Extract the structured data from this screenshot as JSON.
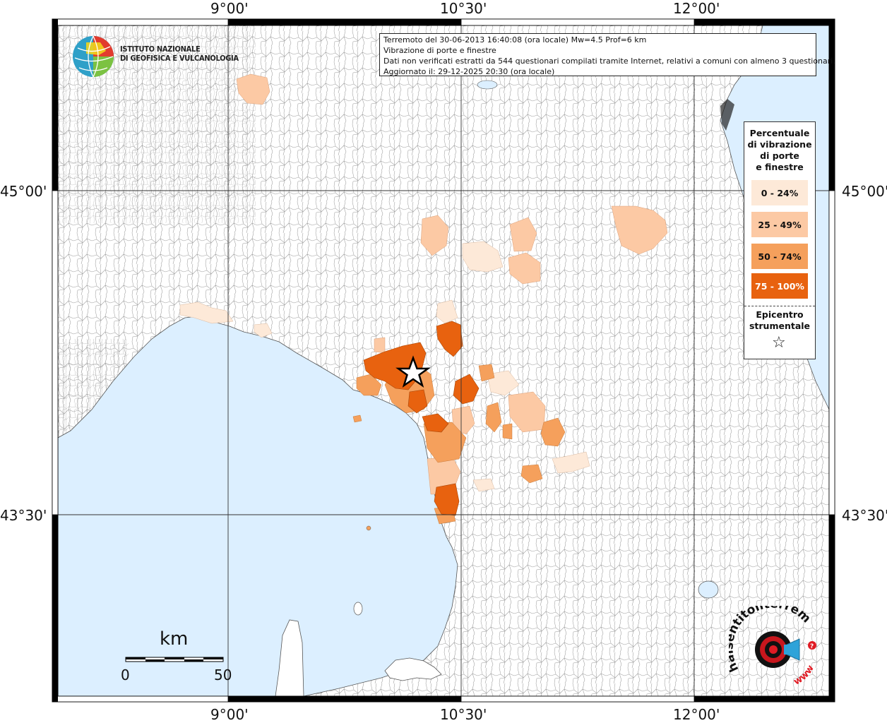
{
  "info": {
    "line1": "Terremoto del 30-06-2013 16:40:08 (ora locale) Mw=4.5 Prof=6 km",
    "line2": "Vibrazione di porte e finestre",
    "line3": "Dati non verificati estratti da 544 questionari compilati tramite Internet, relativi a comuni con almeno 3 questionari.",
    "line4": "Aggiornato il: 29-12-2025 20:30 (ora locale)"
  },
  "axes": {
    "top": [
      "9°00'",
      "10°30'",
      "12°00'"
    ],
    "bottom": [
      "9°00'",
      "10°30'",
      "12°00'"
    ],
    "left": [
      "45°00'",
      "43°30'"
    ],
    "right": [
      "45°00'",
      "43°30'"
    ]
  },
  "legend": {
    "title_lines": [
      "Percentuale",
      "di vibrazione",
      "di porte",
      "e finestre"
    ],
    "classes": [
      {
        "label": "0 - 24%",
        "color": "#fde9d8"
      },
      {
        "label": "25 - 49%",
        "color": "#fcc9a4"
      },
      {
        "label": "50 - 74%",
        "color": "#f5a05c"
      },
      {
        "label": "75 - 100%",
        "color": "#e8620f"
      }
    ],
    "epicenter_lines": [
      "Epicentro",
      "strumentale"
    ],
    "epicenter_symbol": "☆"
  },
  "logo": {
    "line1": "ISTITUTO NAZIONALE",
    "line2": "DI GEOFISICA E VULCANOLOGIA"
  },
  "scale": {
    "unit": "km",
    "min": "0",
    "max": "50"
  },
  "brand": {
    "text": "haisentitoilterremoto.it",
    "url": "www"
  },
  "colors": {
    "sea": "#dcefff",
    "land": "#ffffff",
    "borders": "#9a9a9a",
    "grid": "#333333"
  }
}
